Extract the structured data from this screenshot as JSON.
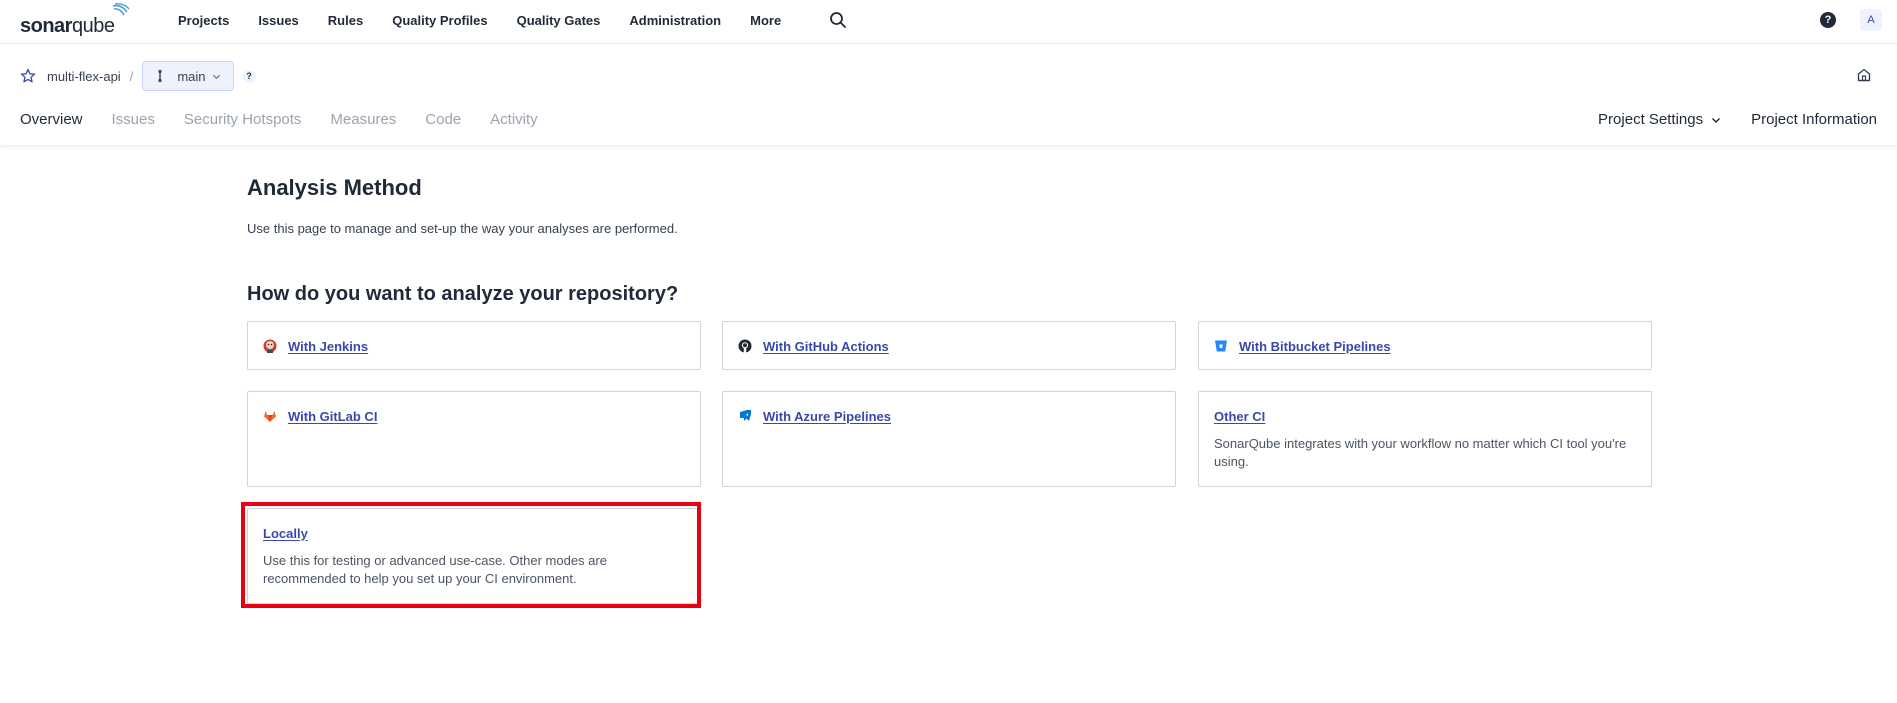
{
  "topnav": {
    "logo_text_a": "sonar",
    "logo_text_b": "qube",
    "items": [
      "Projects",
      "Issues",
      "Rules",
      "Quality Profiles",
      "Quality Gates",
      "Administration",
      "More"
    ],
    "help_label": "?",
    "avatar_letter": "A"
  },
  "project": {
    "name": "multi-flex-api",
    "separator": "/",
    "branch": "main",
    "branch_help": "?",
    "tabs": [
      "Overview",
      "Issues",
      "Security Hotspots",
      "Measures",
      "Code",
      "Activity"
    ],
    "active_tab": "Overview",
    "right_tabs": [
      "Project Settings",
      "Project Information"
    ]
  },
  "main": {
    "title": "Analysis Method",
    "description": "Use this page to manage and set-up the way your analyses are performed.",
    "section_title": "How do you want to analyze your repository?",
    "cards": [
      {
        "label": "With Jenkins",
        "icon": "jenkins-icon"
      },
      {
        "label": "With GitHub Actions",
        "icon": "github-icon"
      },
      {
        "label": "With Bitbucket Pipelines",
        "icon": "bitbucket-icon"
      },
      {
        "label": "With GitLab CI",
        "icon": "gitlab-icon"
      },
      {
        "label": "With Azure Pipelines",
        "icon": "azure-icon"
      },
      {
        "label": "Other CI",
        "description": "SonarQube integrates with your workflow no matter which CI tool you're using."
      },
      {
        "label": "Locally",
        "description": "Use this for testing or advanced use-case. Other modes are recommended to help you set up your CI environment."
      }
    ]
  },
  "colors": {
    "accent": "#3949ab",
    "highlight": "#e60012",
    "text": "#1f2937",
    "muted": "#9ca3af"
  }
}
